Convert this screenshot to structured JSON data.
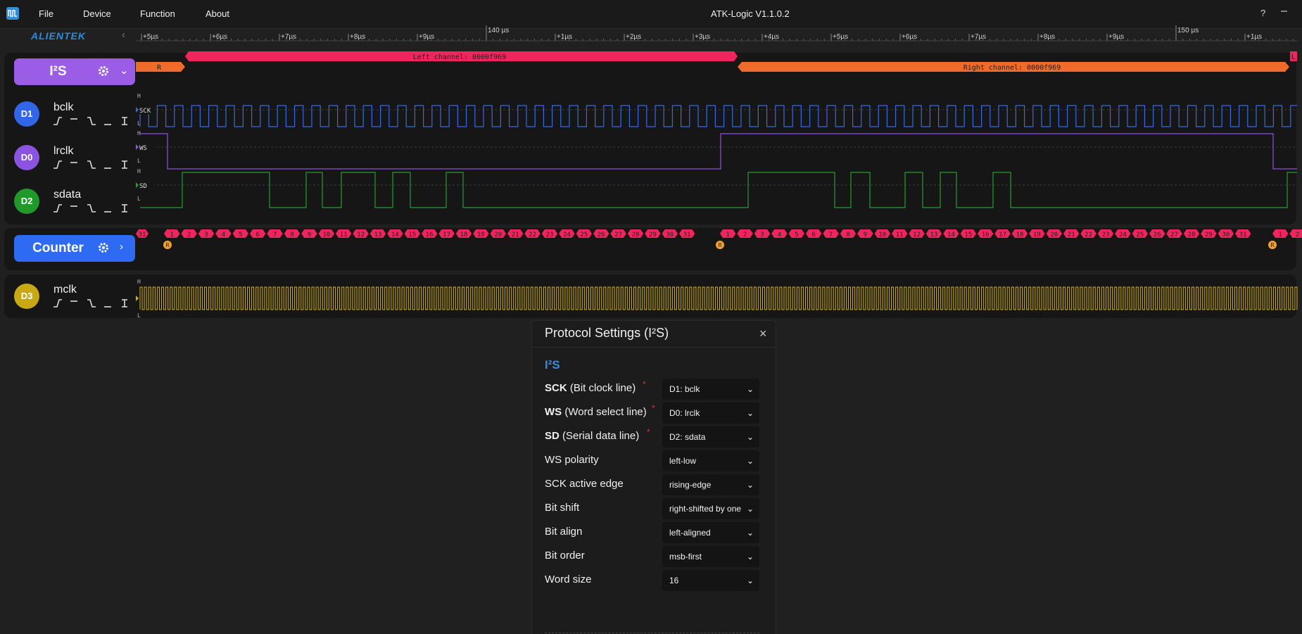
{
  "titlebar": {
    "menu": [
      "File",
      "Device",
      "Function",
      "About"
    ],
    "title": "ATK-Logic  V1.1.0.2",
    "help": "?",
    "minimize": "–"
  },
  "brand": "ALIENTEK",
  "ruler": {
    "labels": [
      "+5µs",
      "+6µs",
      "+7µs",
      "+8µs",
      "+9µs",
      "140 µs",
      "+1µs",
      "+2µs",
      "+3µs",
      "+4µs",
      "+5µs",
      "+6µs",
      "+7µs",
      "+8µs",
      "+9µs",
      "150 µs",
      "+1µs"
    ],
    "major_labels": [
      "140 µs",
      "150 µs"
    ]
  },
  "i2s_panel": {
    "protocol": "I²S",
    "left_channel": "Left channel: 0000f969",
    "right_channel": "Right channel: 0000f969",
    "r_tag": "R",
    "l_tag": "L"
  },
  "channels": [
    {
      "id": "D1",
      "name": "bclk",
      "signal": "SCK",
      "color": "#3569e6"
    },
    {
      "id": "D0",
      "name": "lrclk",
      "signal": "WS",
      "color": "#8b54e0"
    },
    {
      "id": "D2",
      "name": "sdata",
      "signal": "SD",
      "color": "#22a02c"
    },
    {
      "id": "D3",
      "name": "mclk",
      "signal": "",
      "color": "#d4b21a"
    }
  ],
  "level_labels": {
    "high": "H",
    "low": "L"
  },
  "counter": {
    "label": "Counter",
    "seq1": [
      "31",
      "1",
      "2",
      "3",
      "4",
      "5",
      "6",
      "7",
      "8",
      "9",
      "10",
      "11",
      "12",
      "13",
      "14",
      "15",
      "16",
      "17",
      "18",
      "19",
      "20",
      "21",
      "22",
      "23",
      "24",
      "25",
      "26",
      "27",
      "28",
      "29",
      "30",
      "31"
    ],
    "seq2": [
      "1",
      "2",
      "3",
      "4",
      "5",
      "6",
      "7",
      "8",
      "9",
      "10",
      "11",
      "12",
      "13",
      "14",
      "15",
      "16",
      "17",
      "18",
      "19",
      "20",
      "21",
      "22",
      "23",
      "24",
      "25",
      "26",
      "27",
      "28",
      "29",
      "30",
      "31"
    ],
    "seq3": [
      "1",
      "2"
    ],
    "r_marker": "R"
  },
  "colors": {
    "accent": "#3b8be0",
    "protocol_purple": "#9b5de5",
    "counter_blue": "#2f6bf2",
    "left_channel": "#f0255e",
    "right_channel": "#f06b2a"
  },
  "dialog": {
    "title": "Protocol Settings   (I²S)",
    "close": "×",
    "section": "I²S",
    "rows": [
      {
        "key": "SCK",
        "label": "(Bit clock line)",
        "value": "D1: bclk",
        "required": true
      },
      {
        "key": "WS",
        "label": "(Word select line)",
        "value": "D0: lrclk",
        "required": true
      },
      {
        "key": "SD",
        "label": "(Serial data line)",
        "value": "D2: sdata",
        "required": true
      },
      {
        "key": "",
        "label": "WS polarity",
        "value": "left-low",
        "required": false
      },
      {
        "key": "",
        "label": "SCK active edge",
        "value": "rising-edge",
        "required": false
      },
      {
        "key": "",
        "label": "Bit shift",
        "value": "right-shifted by one",
        "required": false
      },
      {
        "key": "",
        "label": "Bit align",
        "value": "left-aligned",
        "required": false
      },
      {
        "key": "",
        "label": "Bit order",
        "value": "msb-first",
        "required": false
      },
      {
        "key": "",
        "label": "Word size",
        "value": "16",
        "required": false
      }
    ]
  }
}
